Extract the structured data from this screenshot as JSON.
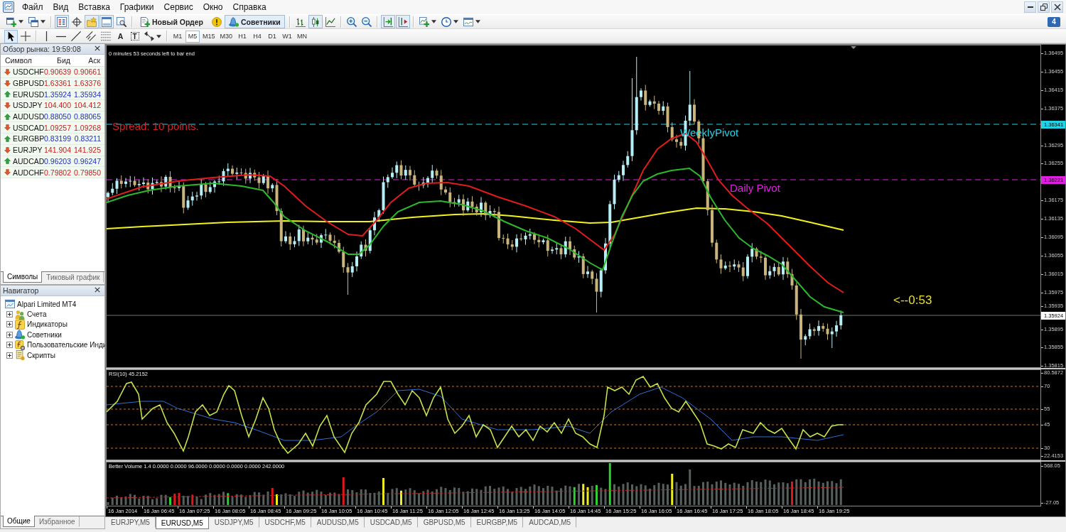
{
  "menu": {
    "items": [
      "Файл",
      "Вид",
      "Вставка",
      "Графики",
      "Сервис",
      "Окно",
      "Справка"
    ]
  },
  "toolbar": {
    "items": [
      {
        "kind": "new-chart",
        "pressed": false,
        "menu": true
      },
      {
        "kind": "profiles",
        "pressed": false,
        "menu": true
      },
      {
        "kind": "separator"
      },
      {
        "kind": "market-watch",
        "pressed": true,
        "menu": false
      },
      {
        "kind": "data-window",
        "pressed": false,
        "menu": false
      },
      {
        "kind": "navigator",
        "pressed": true,
        "menu": false
      },
      {
        "kind": "terminal",
        "pressed": true,
        "menu": false
      },
      {
        "kind": "tester",
        "pressed": false,
        "menu": false
      },
      {
        "kind": "separator"
      },
      {
        "kind": "new-order",
        "label": "Новый Ордер",
        "pressed": false,
        "menu": false
      },
      {
        "kind": "editor",
        "pressed": false,
        "menu": false
      },
      {
        "kind": "experts",
        "label": "Советники",
        "pressed": true,
        "menu": false
      },
      {
        "kind": "separator"
      },
      {
        "kind": "bar-chart",
        "pressed": false,
        "menu": false
      },
      {
        "kind": "candle-chart",
        "pressed": true,
        "menu": false
      },
      {
        "kind": "line-chart",
        "pressed": false,
        "menu": false
      },
      {
        "kind": "separator"
      },
      {
        "kind": "zoom-in",
        "pressed": false,
        "menu": false
      },
      {
        "kind": "zoom-out",
        "pressed": false,
        "menu": false
      },
      {
        "kind": "separator"
      },
      {
        "kind": "auto-scroll",
        "pressed": true,
        "menu": false
      },
      {
        "kind": "chart-shift",
        "pressed": true,
        "menu": false
      },
      {
        "kind": "separator"
      },
      {
        "kind": "indicators",
        "pressed": false,
        "menu": true
      },
      {
        "kind": "periods",
        "pressed": false,
        "menu": true
      },
      {
        "kind": "templates",
        "pressed": false,
        "menu": true
      }
    ],
    "notifications": "4"
  },
  "drawing_toolbar": {
    "tools": [
      {
        "kind": "cursor",
        "pressed": true,
        "menu": false
      },
      {
        "kind": "crosshair",
        "pressed": false,
        "menu": false
      },
      {
        "kind": "separator"
      },
      {
        "kind": "vertical-line",
        "pressed": false,
        "menu": false
      },
      {
        "kind": "horizontal-line",
        "pressed": false,
        "menu": false
      },
      {
        "kind": "trend-line",
        "pressed": false,
        "menu": false
      },
      {
        "kind": "channel",
        "pressed": false,
        "menu": false
      },
      {
        "kind": "fibonacci",
        "pressed": false,
        "menu": false
      },
      {
        "kind": "text",
        "label": "A",
        "pressed": false,
        "menu": false
      },
      {
        "kind": "text-label",
        "label": "T",
        "pressed": false,
        "menu": false
      },
      {
        "kind": "arrows",
        "pressed": false,
        "menu": true
      },
      {
        "kind": "separator"
      }
    ],
    "timeframes": [
      {
        "label": "M1",
        "selected": false
      },
      {
        "label": "M5",
        "selected": true
      },
      {
        "label": "M15",
        "selected": false
      },
      {
        "label": "M30",
        "selected": false
      },
      {
        "label": "H1",
        "selected": false
      },
      {
        "label": "H4",
        "selected": false
      },
      {
        "label": "D1",
        "selected": false
      },
      {
        "label": "W1",
        "selected": false
      },
      {
        "label": "MN",
        "selected": false
      }
    ]
  },
  "market_watch": {
    "title": "Обзор рынка: 19:59:08",
    "columns": [
      "Символ",
      "Бид",
      "Аск"
    ],
    "rows": [
      {
        "symbol": "USDCHF",
        "bid": "0.90639",
        "ask": "0.90661",
        "kind": "down"
      },
      {
        "symbol": "GBPUSD",
        "bid": "1.63361",
        "ask": "1.63376",
        "kind": "down"
      },
      {
        "symbol": "EURUSD",
        "bid": "1.35924",
        "ask": "1.35934",
        "kind": "up"
      },
      {
        "symbol": "USDJPY",
        "bid": "104.400",
        "ask": "104.412",
        "kind": "down"
      },
      {
        "symbol": "AUDUSD",
        "bid": "0.88050",
        "ask": "0.88065",
        "kind": "up"
      },
      {
        "symbol": "USDCAD",
        "bid": "1.09257",
        "ask": "1.09268",
        "kind": "down"
      },
      {
        "symbol": "EURGBP",
        "bid": "0.83199",
        "ask": "0.83211",
        "kind": "up"
      },
      {
        "symbol": "EURJPY",
        "bid": "141.904",
        "ask": "141.925",
        "kind": "down"
      },
      {
        "symbol": "AUDCAD",
        "bid": "0.96203",
        "ask": "0.96247",
        "kind": "up"
      },
      {
        "symbol": "AUDCHF",
        "bid": "0.79802",
        "ask": "0.79850",
        "kind": "down"
      }
    ],
    "tabs": [
      {
        "label": "Символы",
        "selected": true
      },
      {
        "label": "Тиковый график",
        "selected": false
      }
    ]
  },
  "navigator": {
    "title": "Навигатор",
    "tree": [
      {
        "label": "Alpari Limited MT4",
        "kind": "terminal",
        "children": [
          {
            "label": "Счета",
            "kind": "accounts",
            "expanded": false
          },
          {
            "label": "Индикаторы",
            "kind": "indicators",
            "expanded": false
          },
          {
            "label": "Советники",
            "kind": "experts",
            "expanded": false
          },
          {
            "label": "Пользовательские Инди",
            "kind": "custom_indicators",
            "expanded": false
          },
          {
            "label": "Скрипты",
            "kind": "scripts",
            "expanded": false
          }
        ]
      }
    ],
    "tabs": [
      {
        "label": "Общие",
        "selected": true
      },
      {
        "label": "Избранное",
        "selected": false
      }
    ]
  },
  "chart": {
    "timer": "0 minutes 53 seconds left to bar end",
    "spread": "Spread: 10 points.",
    "pivots": [
      {
        "label": "WeeklyPivot",
        "price": "1.36341",
        "color": "#22d3e6"
      },
      {
        "label": "Daily Pivot",
        "price": "1.36221",
        "color": "#e020e0"
      }
    ],
    "bid_price": "1.35924",
    "countdown": "<--0:53",
    "price_axis": [
      "1.36495",
      "1.36455",
      "1.36415",
      "1.36375",
      "1.36295",
      "1.36255",
      "1.36175",
      "1.36135",
      "1.36095",
      "1.36055",
      "1.36015",
      "1.35975",
      "1.35935",
      "1.35895",
      "1.35855",
      "1.35815"
    ],
    "rsi": {
      "title": "RSI(10) 45.2152",
      "axis": [
        "80.5872",
        "70",
        "55",
        "45",
        "30",
        "22.4153"
      ]
    },
    "volume": {
      "title": "Better Volume 1.4 0.0000 0.0000 96.0000 0.0000 0.0000 0.0000 242.0000",
      "axis": [
        "568.05",
        "-27.05"
      ]
    },
    "time_axis": [
      "16 Jan 2014",
      "16 Jan 06:45",
      "16 Jan 07:25",
      "16 Jan 08:05",
      "16 Jan 08:45",
      "16 Jan 09:25",
      "16 Jan 10:05",
      "16 Jan 10:45",
      "16 Jan 11:25",
      "16 Jan 12:05",
      "16 Jan 12:45",
      "16 Jan 13:25",
      "16 Jan 14:05",
      "16 Jan 14:45",
      "16 Jan 15:25",
      "16 Jan 16:05",
      "16 Jan 16:45",
      "16 Jan 17:25",
      "16 Jan 18:05",
      "16 Jan 18:45",
      "16 Jan 19:25"
    ]
  },
  "chart_tabs": [
    {
      "label": "EURJPY,M5",
      "selected": false
    },
    {
      "label": "EURUSD,M5",
      "selected": true
    },
    {
      "label": "USDJPY,M5",
      "selected": false
    },
    {
      "label": "USDCHF,M5",
      "selected": false
    },
    {
      "label": "AUDUSD,M5",
      "selected": false
    },
    {
      "label": "USDCAD,M5",
      "selected": false
    },
    {
      "label": "GBPUSD,M5",
      "selected": false
    },
    {
      "label": "EURGBP,M5",
      "selected": false
    },
    {
      "label": "AUDCAD,M5",
      "selected": false
    }
  ]
}
